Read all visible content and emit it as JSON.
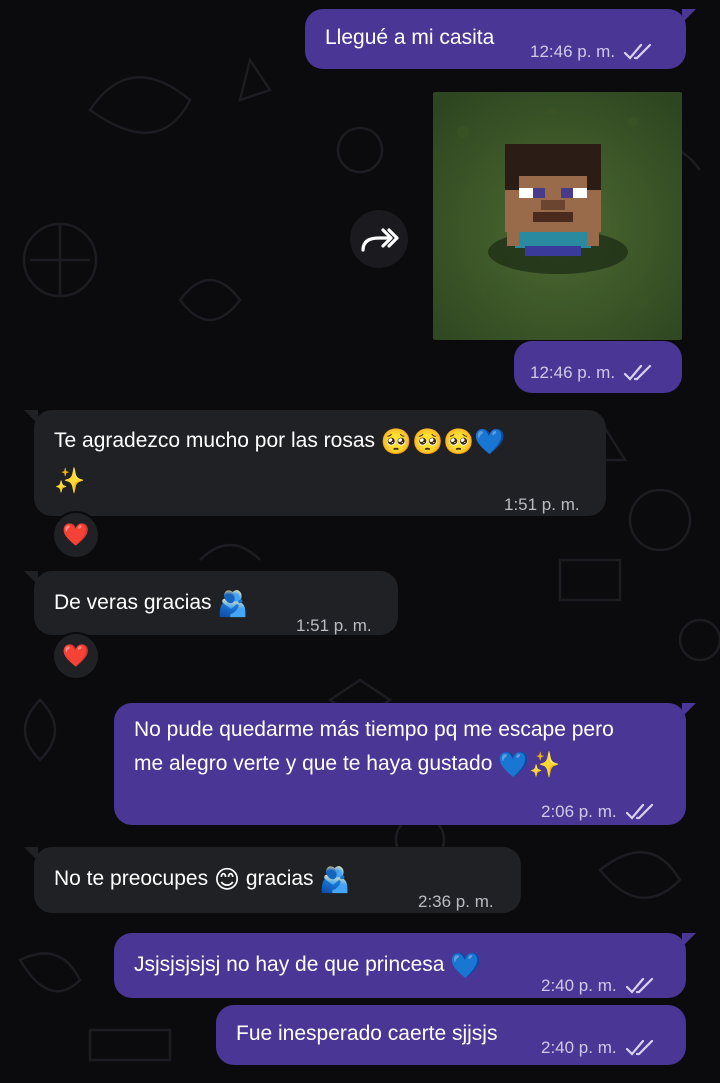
{
  "chat": {
    "messages": [
      {
        "id": "m1",
        "direction": "outgoing",
        "text": "Llegué a mi casita",
        "time": "12:46 p. m.",
        "status": "read"
      },
      {
        "id": "m2",
        "direction": "outgoing",
        "type": "image",
        "image_subject": "Minecraft Steve figure on grass",
        "time": "12:46 p. m.",
        "status": "read"
      },
      {
        "id": "m3",
        "direction": "incoming",
        "text": "Te agradezco mucho por las rosas",
        "emojis": "🥺🥺🥺💙",
        "line2": "✨",
        "time": "1:51 p. m.",
        "reaction": "❤️"
      },
      {
        "id": "m4",
        "direction": "incoming",
        "text": "De veras gracias",
        "emojis": "🫂",
        "time": "1:51 p. m.",
        "reaction": "❤️"
      },
      {
        "id": "m5",
        "direction": "outgoing",
        "text_line1": "No pude quedarme más tiempo pq me escape pero",
        "text_line2": "me alegro verte y que te haya gustado",
        "emojis": "💙✨",
        "time": "2:06 p. m.",
        "status": "read"
      },
      {
        "id": "m6",
        "direction": "incoming",
        "text_a": "No te preocupes",
        "emoji_mid": "😊",
        "text_b": "gracias",
        "emojis": "🫂",
        "time": "2:36 p. m."
      },
      {
        "id": "m7",
        "direction": "outgoing",
        "text": "Jsjsjsjsjsj no hay de que princesa",
        "emojis": "💙",
        "time": "2:40 p. m.",
        "status": "read"
      },
      {
        "id": "m8",
        "direction": "outgoing",
        "text": "Fue inesperado caerte sjjsjs",
        "time": "2:40 p. m.",
        "status": "read"
      }
    ]
  },
  "icons": {
    "forward": "forward-arrow-icon",
    "read_receipt": "double-check-icon"
  },
  "colors": {
    "background": "#0b0b0d",
    "outgoing_bubble": "#4a3795",
    "incoming_bubble": "#202125",
    "meta_text": "#cfc9e8"
  }
}
